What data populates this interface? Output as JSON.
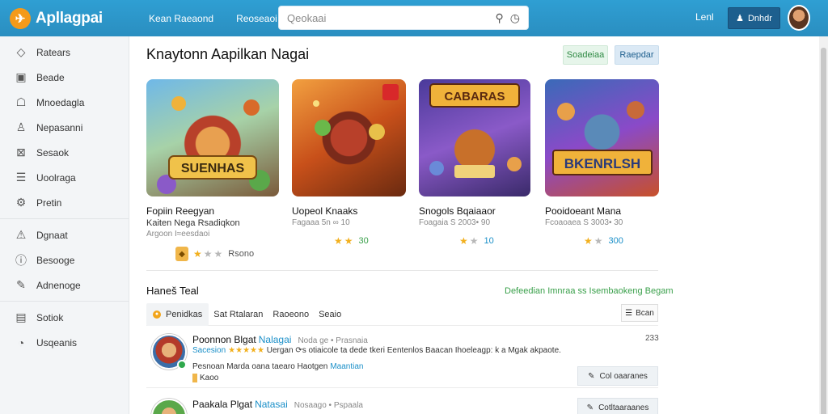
{
  "header": {
    "logo_text": "Apllagpai",
    "nav": [
      "Kean Raeaond",
      "Reoseaoi"
    ],
    "search_placeholder": "Qeokaai",
    "link": "Lenl",
    "button_label": "Dnhdr"
  },
  "sidebar": {
    "items": [
      {
        "label": "Ratears",
        "icon": "layers-icon"
      },
      {
        "label": "Beade",
        "icon": "calendar-icon"
      },
      {
        "label": "Mnoedagla",
        "icon": "user-icon"
      },
      {
        "label": "Nepasanni",
        "icon": "user-outline-icon"
      },
      {
        "label": "Sesaok",
        "icon": "filter-box-icon"
      },
      {
        "label": "Uoolraga",
        "icon": "list-box-icon"
      },
      {
        "label": "Pretin",
        "icon": "settings-icon"
      },
      {
        "label": "Dgnaat",
        "icon": "warning-icon"
      },
      {
        "label": "Besooge",
        "icon": "info-circle-icon"
      },
      {
        "label": "Adnenoge",
        "icon": "pencil-icon"
      },
      {
        "label": "Sotiok",
        "icon": "document-icon"
      },
      {
        "label": "Usqeanis",
        "icon": "clock-icon"
      }
    ]
  },
  "main": {
    "title": "Knaytonn Aapilkan Nagai",
    "pill_a": "Soadeiaa",
    "pill_b": "Raepdar",
    "cards": [
      {
        "title": "Fopiin Reegyan",
        "subtitle": "Kaiten Nega Rsadiqkon",
        "meta": "Argoon I≈eesdaoi",
        "rating": "Rsono",
        "stars": 1,
        "art": "SUENHAS"
      },
      {
        "title": "Uopeol Knaaks",
        "subtitle": "",
        "meta": "Fagaaa 5n ∞ 10",
        "rating": "30",
        "stars": 2,
        "art": ""
      },
      {
        "title": "Snogols Bqaiaaor",
        "subtitle": "",
        "meta": "Foagaia S 2003• 90",
        "rating": "10",
        "stars": 1,
        "art": "CABARAS"
      },
      {
        "title": "Pooidoeant Mana",
        "subtitle": "",
        "meta": "Fcoaoaea S 3003• 30",
        "rating": "300",
        "stars": 1,
        "art": "BKENRLSH"
      }
    ],
    "section_title": "Haneš Teal",
    "section_link": "Defeedian Imnraa ss Isembaokeng Begam",
    "tabs": [
      "Penidkas",
      "Sat Rtalaran",
      "Raoeono",
      "Seaio"
    ],
    "sort_label": "Bcan",
    "reviews": [
      {
        "name": "Poonnon Blgat",
        "tag": "Nalagai",
        "meta": "Noda ge • Prasnaia",
        "label": "Sacesion",
        "stars": "★★★★★",
        "text": "Uergan ⟳s otiaicole ta dede tkeri Eentenlos Baacan Ihoeleagp: k a Mgak akpaote.",
        "line3": "Pesnoan Marda oana taearo Haotgen",
        "line3_tag": "Maantian",
        "line4": "Kaoo",
        "count": "233",
        "button": "Col oaaranes"
      },
      {
        "name": "Paakala Plgat",
        "tag": "Natasai",
        "meta": "Nosaago • Pspaala",
        "button": "Cotltaaraanes"
      }
    ]
  },
  "colors": {
    "header_bg": "#2f9fd3",
    "accent_blue": "#1a8fc8",
    "accent_green": "#3aa04b",
    "star": "#f2b01e"
  }
}
